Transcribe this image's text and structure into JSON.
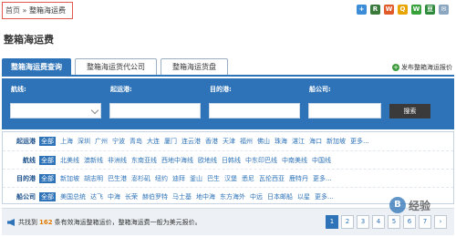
{
  "breadcrumb": {
    "home": "首页",
    "sep": "»",
    "current": "整箱海运费"
  },
  "share_buttons": [
    {
      "icon": "add-icon",
      "color": "#3b8dd8",
      "glyph": "+"
    },
    {
      "icon": "renren-icon",
      "color": "#3a7a3a",
      "glyph": "R"
    },
    {
      "icon": "weibo-icon",
      "color": "#e05a2a",
      "glyph": "W"
    },
    {
      "icon": "qzone-icon",
      "color": "#e8a400",
      "glyph": "Q"
    },
    {
      "icon": "wechat-icon",
      "color": "#37a13a",
      "glyph": "W"
    },
    {
      "icon": "douban-icon",
      "color": "#2c8a3a",
      "glyph": "豆"
    },
    {
      "icon": "email-icon",
      "color": "#8aa6c0",
      "glyph": "✉"
    }
  ],
  "page_title": "整箱海运费",
  "tabs": [
    {
      "label": "整箱海运费查询",
      "active": true
    },
    {
      "label": "整箱海运货代公司",
      "active": false
    },
    {
      "label": "整箱海运货盘",
      "active": false
    }
  ],
  "publish": {
    "label": "发布整箱海运报价"
  },
  "search": {
    "route_label": "航线:",
    "origin_label": "起运港:",
    "destination_label": "目的港:",
    "carrier_label": "船公司:",
    "button_label": "搜索"
  },
  "filters": [
    {
      "label": "起运港",
      "items": [
        "全部",
        "上海",
        "深圳",
        "广州",
        "宁波",
        "青岛",
        "大连",
        "厦门",
        "连云港",
        "香港",
        "天津",
        "福州",
        "佛山",
        "珠海",
        "湛江",
        "海口",
        "新加坡",
        "更多..."
      ]
    },
    {
      "label": "航线",
      "items": [
        "全部",
        "北美线",
        "澳新线",
        "非洲线",
        "东南亚线",
        "西地中海线",
        "欧地线",
        "日韩线",
        "中东印巴线",
        "中南美线",
        "中国线"
      ]
    },
    {
      "label": "目的港",
      "items": [
        "全部",
        "新加坡",
        "胡志明",
        "巴生港",
        "澎杉矶",
        "纽约",
        "迪拜",
        "釜山",
        "巴生",
        "汉堡",
        "悉尼",
        "瓦伦西亚",
        "鹿特丹",
        "更多..."
      ]
    },
    {
      "label": "船公司",
      "items": [
        "全部",
        "美国总统",
        "达飞",
        "中海",
        "长荣",
        "赫伯罗特",
        "马士基",
        "地中海",
        "东方海外",
        "中远",
        "日本邮船",
        "以星",
        "更多..."
      ]
    }
  ],
  "footer": {
    "prefix": "共找到",
    "count": "162",
    "suffix": "条有效海运整箱运价，整箱海运费一般为美元报价。",
    "pages": [
      "1",
      "2",
      "3",
      "4",
      "5",
      "6",
      "7",
      "›"
    ],
    "current_page": "1"
  },
  "watermark": {
    "glyph": "B",
    "text": "经验"
  }
}
